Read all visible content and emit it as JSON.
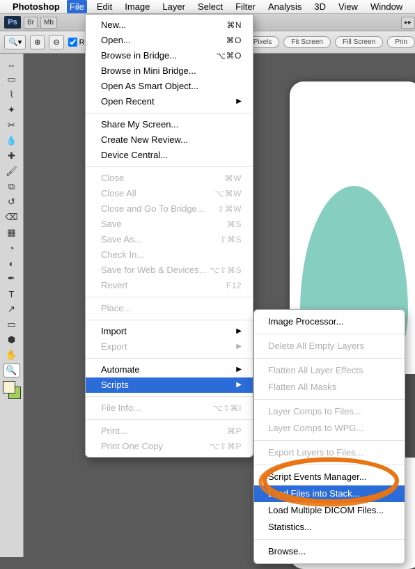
{
  "menubar": {
    "appname": "Photoshop",
    "items": [
      "File",
      "Edit",
      "Image",
      "Layer",
      "Select",
      "Filter",
      "Analysis",
      "3D",
      "View",
      "Window"
    ],
    "active": "File"
  },
  "ps_tabs": {
    "logo": "Ps",
    "btn1": "Br",
    "btn2": "Mb"
  },
  "options": {
    "resize": "Resi",
    "btn_actual": "ctual Pixels",
    "btn_fit": "Fit Screen",
    "btn_fill": "Fill Screen",
    "btn_print": "Prin"
  },
  "file_menu": {
    "sections": [
      [
        {
          "label": "New...",
          "shortcut": "⌘N"
        },
        {
          "label": "Open...",
          "shortcut": "⌘O"
        },
        {
          "label": "Browse in Bridge...",
          "shortcut": "⌥⌘O"
        },
        {
          "label": "Browse in Mini Bridge..."
        },
        {
          "label": "Open As Smart Object..."
        },
        {
          "label": "Open Recent",
          "submenu": true
        }
      ],
      [
        {
          "label": "Share My Screen..."
        },
        {
          "label": "Create New Review..."
        },
        {
          "label": "Device Central..."
        }
      ],
      [
        {
          "label": "Close",
          "shortcut": "⌘W",
          "disabled": true
        },
        {
          "label": "Close All",
          "shortcut": "⌥⌘W",
          "disabled": true
        },
        {
          "label": "Close and Go To Bridge...",
          "shortcut": "⇧⌘W",
          "disabled": true
        },
        {
          "label": "Save",
          "shortcut": "⌘S",
          "disabled": true
        },
        {
          "label": "Save As...",
          "shortcut": "⇧⌘S",
          "disabled": true
        },
        {
          "label": "Check In...",
          "disabled": true
        },
        {
          "label": "Save for Web & Devices...",
          "shortcut": "⌥⇧⌘S",
          "disabled": true
        },
        {
          "label": "Revert",
          "shortcut": "F12",
          "disabled": true
        }
      ],
      [
        {
          "label": "Place...",
          "disabled": true
        }
      ],
      [
        {
          "label": "Import",
          "submenu": true
        },
        {
          "label": "Export",
          "submenu": true,
          "disabled": true
        }
      ],
      [
        {
          "label": "Automate",
          "submenu": true
        },
        {
          "label": "Scripts",
          "submenu": true,
          "hl": true
        }
      ],
      [
        {
          "label": "File Info...",
          "shortcut": "⌥⇧⌘I",
          "disabled": true
        }
      ],
      [
        {
          "label": "Print...",
          "shortcut": "⌘P",
          "disabled": true
        },
        {
          "label": "Print One Copy",
          "shortcut": "⌥⇧⌘P",
          "disabled": true
        }
      ]
    ]
  },
  "scripts_submenu": {
    "sections": [
      [
        {
          "label": "Image Processor..."
        }
      ],
      [
        {
          "label": "Delete All Empty Layers",
          "disabled": true
        }
      ],
      [
        {
          "label": "Flatten All Layer Effects",
          "disabled": true
        },
        {
          "label": "Flatten All Masks",
          "disabled": true
        }
      ],
      [
        {
          "label": "Layer Comps to Files...",
          "disabled": true
        },
        {
          "label": "Layer Comps to WPG...",
          "disabled": true
        }
      ],
      [
        {
          "label": "Export Layers to Files...",
          "disabled": true
        }
      ],
      [
        {
          "label": "Script Events Manager..."
        },
        {
          "label": "Load Files into Stack...",
          "hl": true
        },
        {
          "label": "Load Multiple DICOM Files..."
        },
        {
          "label": "Statistics..."
        }
      ],
      [
        {
          "label": "Browse..."
        }
      ]
    ]
  },
  "tools": [
    "move",
    "marquee",
    "lasso",
    "wand",
    "crop",
    "eyedropper",
    "heal",
    "brush",
    "stamp",
    "history",
    "eraser",
    "gradient",
    "blur",
    "dodge",
    "pen",
    "type",
    "path",
    "shape",
    "3d",
    "hand",
    "zoom"
  ]
}
